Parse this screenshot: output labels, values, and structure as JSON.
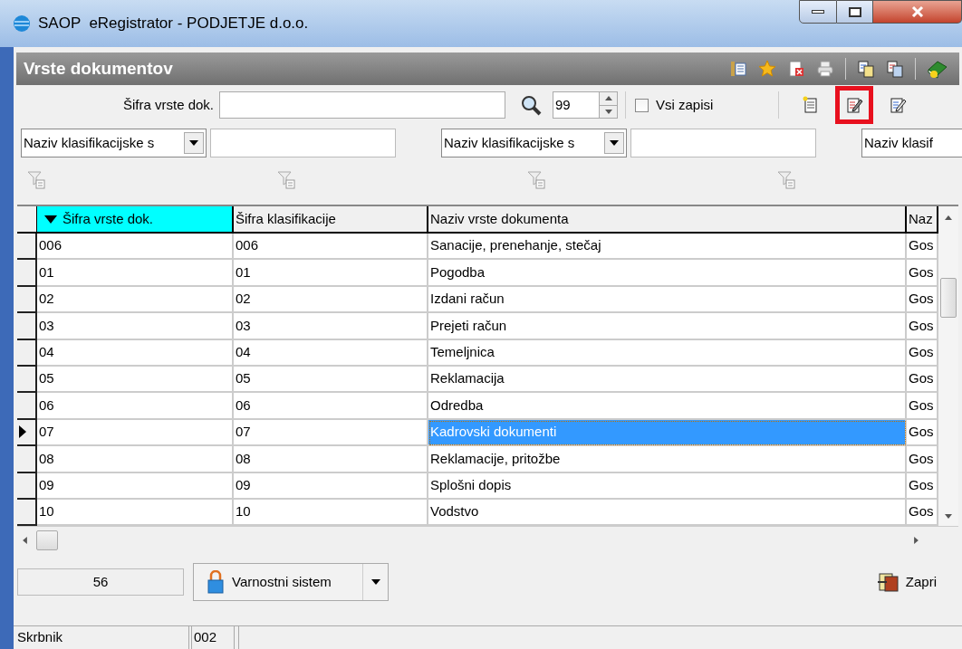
{
  "window": {
    "title": "SAOP  eRegistrator - PODJETJE d.o.o."
  },
  "panel": {
    "title": "Vrste dokumentov",
    "header_tools": [
      {
        "kind": "list"
      },
      {
        "kind": "star"
      },
      {
        "kind": "delete"
      },
      {
        "kind": "print"
      },
      {
        "kind": "sep"
      },
      {
        "kind": "copy"
      },
      {
        "kind": "copy2"
      },
      {
        "kind": "sep"
      },
      {
        "kind": "help"
      }
    ]
  },
  "filter": {
    "label": "Šifra vrste dok.",
    "count": "99",
    "all_records": {
      "label": "Vsi zapisi",
      "checked": false
    },
    "actions": [
      {
        "kind": "new",
        "highlighted": false
      },
      {
        "kind": "edit",
        "highlighted": true
      },
      {
        "kind": "edit2",
        "highlighted": false
      }
    ]
  },
  "column_filters": [
    {
      "field": "Naziv klasifikacijske s",
      "has_value_field": true
    },
    {
      "field": "Naziv klasifikacijske s",
      "has_value_field": true
    },
    {
      "field": "Naziv klasif",
      "has_value_field": false
    }
  ],
  "table": {
    "columns": [
      {
        "label": "Šifra vrste dok.",
        "sorted": true
      },
      {
        "label": "Šifra klasifikacije",
        "sorted": false
      },
      {
        "label": "Naziv vrste dokumenta",
        "sorted": false
      },
      {
        "label": "Naz",
        "sorted": false
      }
    ],
    "rows": [
      {
        "cells": [
          "006",
          "006",
          "Sanacije, prenehanje, stečaj",
          "Gos"
        ],
        "selected": false
      },
      {
        "cells": [
          "01",
          "01",
          "Pogodba",
          "Gos"
        ],
        "selected": false
      },
      {
        "cells": [
          "02",
          "02",
          "Izdani račun",
          "Gos"
        ],
        "selected": false
      },
      {
        "cells": [
          "03",
          "03",
          "Prejeti račun",
          "Gos"
        ],
        "selected": false
      },
      {
        "cells": [
          "04",
          "04",
          "Temeljnica",
          "Gos"
        ],
        "selected": false
      },
      {
        "cells": [
          "05",
          "05",
          "Reklamacija",
          "Gos"
        ],
        "selected": false
      },
      {
        "cells": [
          "06",
          "06",
          "Odredba",
          "Gos"
        ],
        "selected": false
      },
      {
        "cells": [
          "07",
          "07",
          "Kadrovski dokumenti",
          "Gos"
        ],
        "selected": true
      },
      {
        "cells": [
          "08",
          "08",
          "Reklamacije, pritožbe",
          "Gos"
        ],
        "selected": false
      },
      {
        "cells": [
          "09",
          "09",
          "Splošni dopis",
          "Gos"
        ],
        "selected": false
      },
      {
        "cells": [
          "10",
          "10",
          "Vodstvo",
          "Gos"
        ],
        "selected": false
      }
    ]
  },
  "footer": {
    "record_count": "56",
    "security_button": "Varnostni sistem",
    "close_button": "Zapri"
  },
  "status_bar": {
    "user": "Skrbnik",
    "code": "002"
  }
}
